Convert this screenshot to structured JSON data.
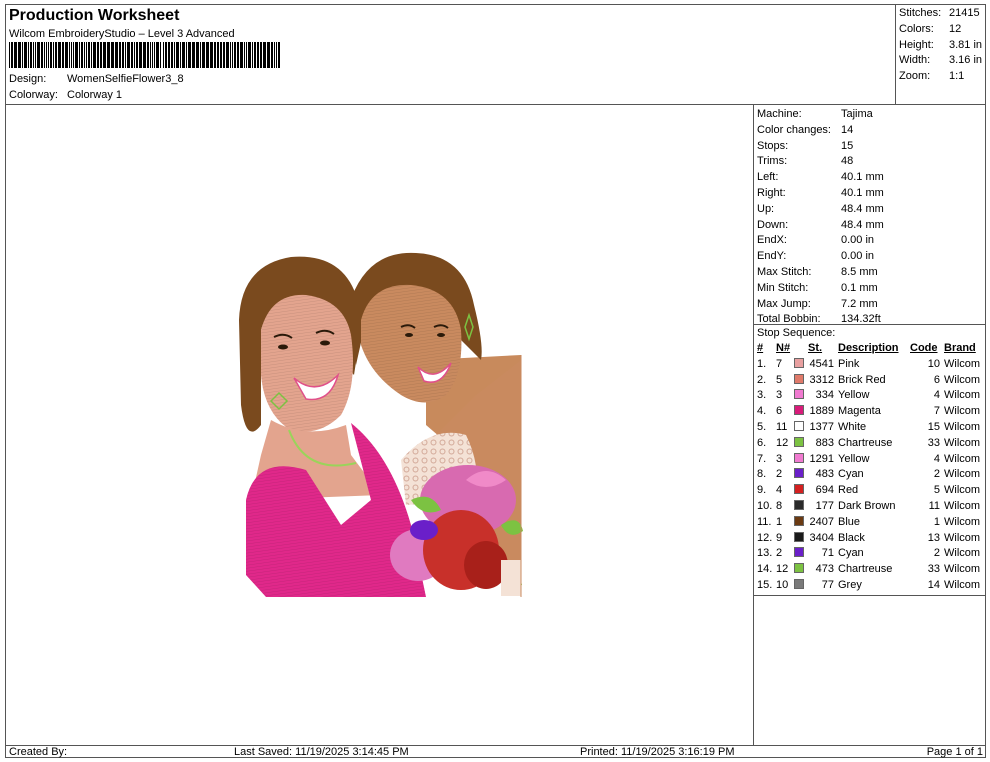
{
  "header": {
    "title": "Production Worksheet",
    "software": "Wilcom EmbroideryStudio – Level 3 Advanced",
    "design_label": "Design:",
    "design_value": "WomenSelfieFlower3_8",
    "colorway_label": "Colorway:",
    "colorway_value": "Colorway 1"
  },
  "summary": [
    {
      "label": "Stitches:",
      "value": "21415"
    },
    {
      "label": "Colors:",
      "value": "12"
    },
    {
      "label": "Height:",
      "value": "3.81 in"
    },
    {
      "label": "Width:",
      "value": "3.16 in"
    },
    {
      "label": "Zoom:",
      "value": "1:1"
    }
  ],
  "machine_info": [
    {
      "label": "Machine:",
      "value": "Tajima"
    },
    {
      "label": "Color changes:",
      "value": "14"
    },
    {
      "label": "Stops:",
      "value": "15"
    },
    {
      "label": "Trims:",
      "value": "48"
    },
    {
      "label": "Left:",
      "value": "40.1 mm"
    },
    {
      "label": "Right:",
      "value": "40.1 mm"
    },
    {
      "label": "Up:",
      "value": "48.4 mm"
    },
    {
      "label": "Down:",
      "value": "48.4 mm"
    },
    {
      "label": "EndX:",
      "value": "0.00 in"
    },
    {
      "label": "EndY:",
      "value": "0.00 in"
    },
    {
      "label": "Max Stitch:",
      "value": "8.5 mm"
    },
    {
      "label": "Min Stitch:",
      "value": "0.1 mm"
    },
    {
      "label": "Max Jump:",
      "value": "7.2 mm"
    },
    {
      "label": "Total Bobbin:",
      "value": "134.32ft"
    }
  ],
  "stop_sequence": {
    "title": "Stop Sequence:",
    "columns": {
      "num": "#",
      "n": "N#",
      "st": "St.",
      "desc": "Description",
      "code": "Code",
      "brand": "Brand"
    },
    "rows": [
      {
        "num": "1.",
        "n": "7",
        "color": "#e8a0a0",
        "st": "4541",
        "desc": "Pink",
        "code": "10",
        "brand": "Wilcom"
      },
      {
        "num": "2.",
        "n": "5",
        "color": "#e07a6a",
        "st": "3312",
        "desc": "Brick Red",
        "code": "6",
        "brand": "Wilcom"
      },
      {
        "num": "3.",
        "n": "3",
        "color": "#f07ad0",
        "st": "334",
        "desc": "Yellow",
        "code": "4",
        "brand": "Wilcom"
      },
      {
        "num": "4.",
        "n": "6",
        "color": "#d81b7a",
        "st": "1889",
        "desc": "Magenta",
        "code": "7",
        "brand": "Wilcom"
      },
      {
        "num": "5.",
        "n": "11",
        "color": "#ffffff",
        "st": "1377",
        "desc": "White",
        "code": "15",
        "brand": "Wilcom"
      },
      {
        "num": "6.",
        "n": "12",
        "color": "#7cc242",
        "st": "883",
        "desc": "Chartreuse",
        "code": "33",
        "brand": "Wilcom"
      },
      {
        "num": "7.",
        "n": "3",
        "color": "#f07ad0",
        "st": "1291",
        "desc": "Yellow",
        "code": "4",
        "brand": "Wilcom"
      },
      {
        "num": "8.",
        "n": "2",
        "color": "#6a1fc9",
        "st": "483",
        "desc": "Cyan",
        "code": "2",
        "brand": "Wilcom"
      },
      {
        "num": "9.",
        "n": "4",
        "color": "#d42020",
        "st": "694",
        "desc": "Red",
        "code": "5",
        "brand": "Wilcom"
      },
      {
        "num": "10.",
        "n": "8",
        "color": "#2a2a2a",
        "st": "177",
        "desc": "Dark Brown",
        "code": "11",
        "brand": "Wilcom"
      },
      {
        "num": "11.",
        "n": "1",
        "color": "#6b3a12",
        "st": "2407",
        "desc": "Blue",
        "code": "1",
        "brand": "Wilcom"
      },
      {
        "num": "12.",
        "n": "9",
        "color": "#1a1a1a",
        "st": "3404",
        "desc": "Black",
        "code": "13",
        "brand": "Wilcom"
      },
      {
        "num": "13.",
        "n": "2",
        "color": "#6a1fc9",
        "st": "71",
        "desc": "Cyan",
        "code": "2",
        "brand": "Wilcom"
      },
      {
        "num": "14.",
        "n": "12",
        "color": "#7cc242",
        "st": "473",
        "desc": "Chartreuse",
        "code": "33",
        "brand": "Wilcom"
      },
      {
        "num": "15.",
        "n": "10",
        "color": "#7a7a7a",
        "st": "77",
        "desc": "Grey",
        "code": "14",
        "brand": "Wilcom"
      }
    ]
  },
  "footer": {
    "created_by": "Created By:",
    "last_saved": "Last Saved: 11/19/2025 3:14:45 PM",
    "printed": "Printed: 11/19/2025 3:16:19 PM",
    "page": "Page 1 of 1"
  },
  "colors": {
    "hair_brown": "#7a4a1e",
    "skin_light": "#e3a48e",
    "skin_dark": "#c98a5f",
    "top_magenta": "#e0288a",
    "flower_pink": "#d86ab0",
    "flower_red": "#c8302a",
    "leaf_green": "#7cc242",
    "lace_white": "#f1ddd0"
  }
}
